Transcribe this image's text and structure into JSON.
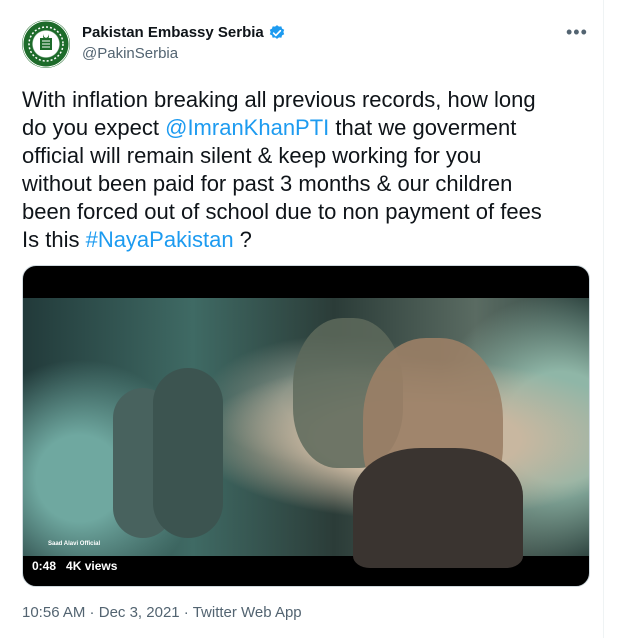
{
  "author": {
    "name": "Pakistan Embassy Serbia",
    "handle": "@PakinSerbia",
    "verified": true
  },
  "tweet": {
    "line1": "With inflation breaking all previous records, how long",
    "line2_pre": "do you expect ",
    "mention": "@ImranKhanPTI",
    "line2_post": " that we goverment",
    "line3": "official will remain silent & keep working for you",
    "line4": "without been paid for past 3 months & our children",
    "line5": "been forced out of school due to non payment of fees",
    "line6_pre": "Is this ",
    "hashtag": "#NayaPakistan",
    "line6_post": "  ?"
  },
  "media": {
    "duration": "0:48",
    "views": "4K views",
    "watermark": "Saad Alavi Official"
  },
  "footer": {
    "time": "10:56 AM",
    "sep1": " · ",
    "date": "Dec 3, 2021",
    "sep2": " · ",
    "source": "Twitter Web App"
  },
  "colors": {
    "link": "#1d9bf0",
    "muted": "#536471",
    "text": "#0f1419"
  },
  "icons": [
    "embassy-logo-icon",
    "verified-badge-icon",
    "more-options-icon"
  ]
}
